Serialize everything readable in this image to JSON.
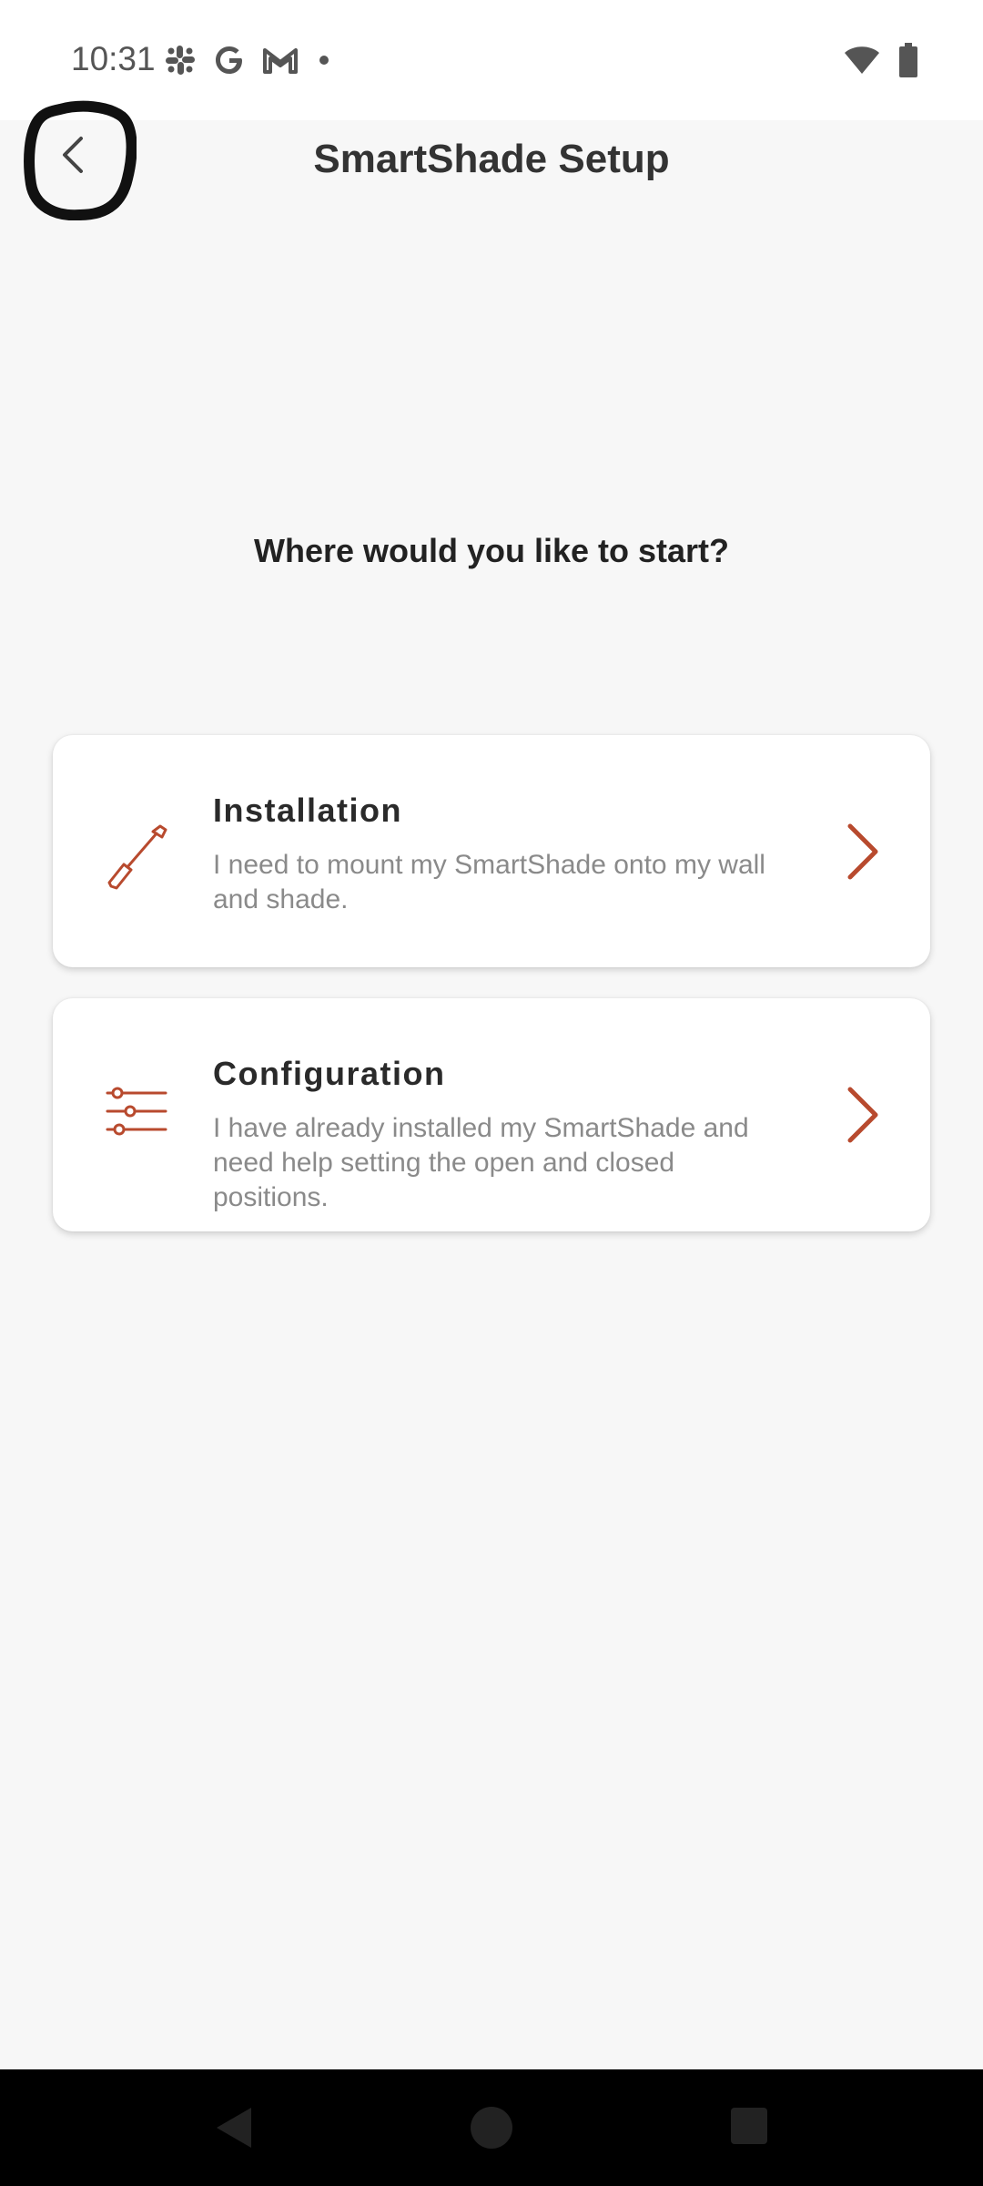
{
  "status_bar": {
    "time": "10:31",
    "left_icons": [
      "slack-icon",
      "google-icon",
      "gmail-icon",
      "notification-dot-icon"
    ],
    "right_icons": [
      "wifi-icon",
      "battery-icon"
    ]
  },
  "app_bar": {
    "title": "SmartShade Setup",
    "back_icon": "chevron-left-icon"
  },
  "main": {
    "prompt": "Where would you like to start?",
    "options": [
      {
        "title": "Installation",
        "description": "I need to mount my SmartShade onto my wall and shade.",
        "icon": "screwdriver-icon"
      },
      {
        "title": "Configuration",
        "description": "I have already installed my SmartShade and need help setting the open and closed positions.",
        "icon": "sliders-icon"
      }
    ]
  },
  "colors": {
    "accent": "#b84a2e",
    "background": "#f7f7f7",
    "card": "#ffffff",
    "title_text": "#333333",
    "secondary_text": "#8a8a8a"
  },
  "nav_bar": {
    "buttons": [
      "back-triangle-icon",
      "home-circle-icon",
      "recents-square-icon"
    ]
  }
}
